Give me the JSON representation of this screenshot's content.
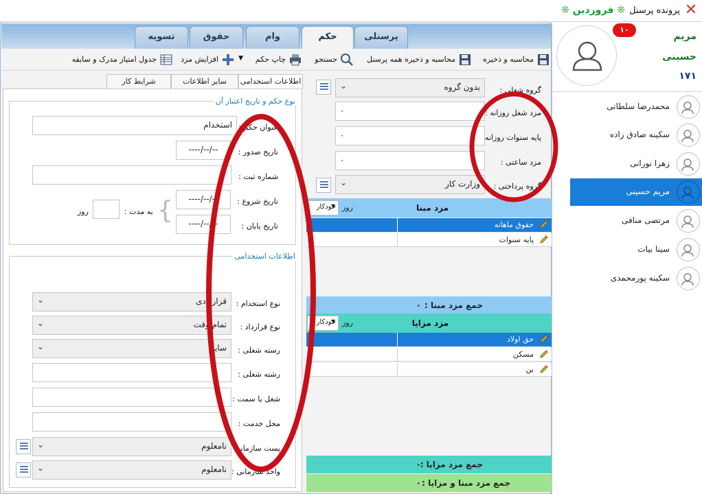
{
  "window": {
    "title": "پرونده پرسنل",
    "month": "❊ فروردین ❊"
  },
  "profile": {
    "first_name": "مریم",
    "last_name": "حسینی",
    "id": "۱۷۱",
    "badge": "۱۰"
  },
  "people": [
    {
      "name": "محمدرضا سلطانی",
      "active": false
    },
    {
      "name": "سکینه صادق زاده",
      "active": false
    },
    {
      "name": "زهرا نورانی",
      "active": false
    },
    {
      "name": "مریم حسینی",
      "active": true
    },
    {
      "name": "مرتضی منافی",
      "active": false
    },
    {
      "name": "سینا بیات",
      "active": false
    },
    {
      "name": "سکینه پورمحمدی",
      "active": false
    }
  ],
  "tabs": {
    "personnel": "پرسنلی",
    "decree": "حکم",
    "loan": "وام",
    "salary": "حقوق",
    "settlement": "تسویه",
    "active": "decree"
  },
  "toolbar": {
    "calc_save": "محاسبه و ذخیره",
    "calc_save_all": "محاسبه و ذخیره همه پرسنل",
    "search": "جستجو",
    "print_decree": "چاپ حکم",
    "raise_wage": "افزایش مزد",
    "score_table": "جدول امتیاز مدرک و سابقه"
  },
  "subtabs": {
    "employment_info": "اطلاعات استخدامی",
    "other_info": "سایر اطلاعات",
    "work_conditions": "شرایط کار"
  },
  "decree_group": {
    "title": "نوع حکم و تاریخ اعتبار آن",
    "title_label": "عنوان حکم :",
    "title_value": "استخدام",
    "issue_date_label": "تاریخ صدور :",
    "issue_date_value": "----/--/--",
    "reg_number_label": "شماره ثبت :",
    "start_date_label": "تاریخ شروع :",
    "start_date_value": "----/--/--",
    "end_date_label": "تاریخ پایان :",
    "end_date_value": "----/--/--",
    "duration_label": "به مدت :",
    "duration_unit": "روز"
  },
  "employment_group": {
    "title": "اطلاعات استخدامی",
    "hire_type_label": "نوع استخدام :",
    "hire_type_value": "قراردادی",
    "contract_type_label": "نوع قرارداد :",
    "contract_type_value": "تمام وقت",
    "job_category_label": "رسته شغلی :",
    "job_category_value": "سایر",
    "job_field_label": "رشته شغلی :",
    "position_label": "شغل یا سمت :",
    "workplace_label": "محل خدمت :",
    "org_post_label": "پست سازمانی :",
    "org_post_value": "نامعلوم",
    "org_unit_label": "واحد سازمانی :",
    "org_unit_value": "نامعلوم"
  },
  "wage_params": {
    "job_group_label": "گروه شغلی :",
    "job_group_value": "بدون گروه",
    "daily_wage_label": "مزد شغل روزانه :",
    "daily_wage_value": "۰",
    "daily_seniority_label": "پایه سنوات روزانه :",
    "daily_seniority_value": "۰",
    "hourly_wage_label": "مزد ساعتی :",
    "hourly_wage_value": "۰",
    "pay_group_label": "گروه پرداختی :",
    "pay_group_value": "وزارت کار"
  },
  "base_wage": {
    "title": "مزد مبنا",
    "unit": "روز",
    "mode": "خودکار",
    "items": [
      "حقوق ماهانه",
      "پایه سنوات"
    ],
    "sum_label": "جمع مزد مبنا :",
    "sum_value": "۰"
  },
  "benefits": {
    "title": "مزد مزایا",
    "unit": "روز",
    "mode": "خودکار",
    "items": [
      "حق اولاد",
      "مسکن",
      "بن"
    ],
    "sum_label": "جمع مزد مزایا :",
    "sum_value": "۰"
  },
  "total": {
    "label": "جمع مزد مبنا و مزایا :",
    "value": "۰"
  },
  "colors": {
    "accent": "#1a7dd7",
    "base_header": "#8ecbf4",
    "benefit_header": "#4fd3c4",
    "total_bar": "#9ee38f",
    "annotation": "#c8101a"
  }
}
